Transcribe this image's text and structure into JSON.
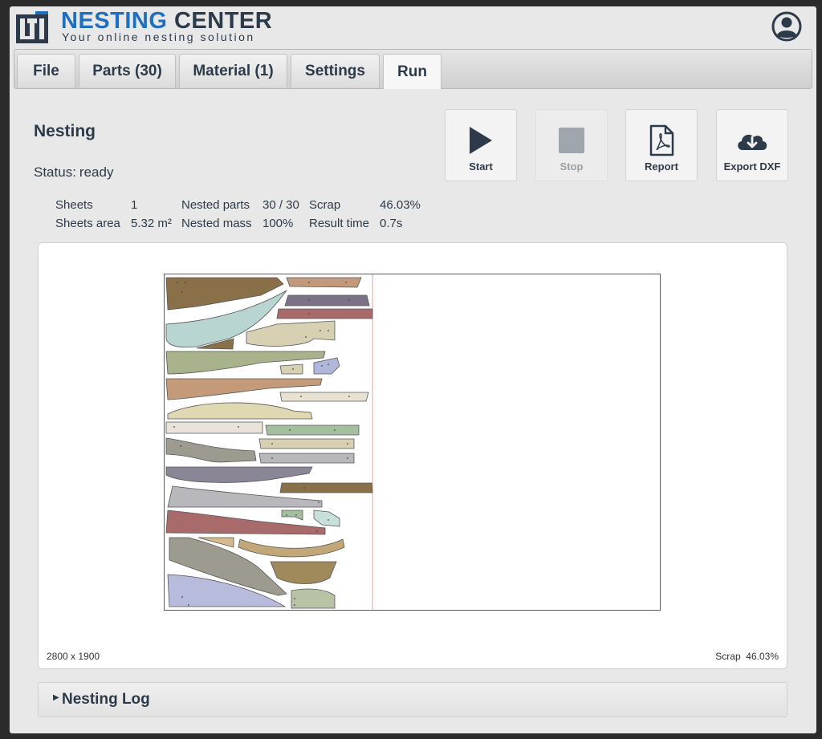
{
  "brand": {
    "name_part1": "NESTING",
    "name_part2": "CENTER",
    "tagline": "Your online nesting solution"
  },
  "tabs": [
    {
      "label": "File"
    },
    {
      "label": "Parts (30)"
    },
    {
      "label": "Material (1)"
    },
    {
      "label": "Settings"
    },
    {
      "label": "Run",
      "active": true
    }
  ],
  "page": {
    "title": "Nesting",
    "status_label": "Status:",
    "status_value": "ready"
  },
  "actions": {
    "start": "Start",
    "stop": "Stop",
    "report": "Report",
    "export": "Export DXF"
  },
  "stats": {
    "sheets_label": "Sheets",
    "sheets_value": "1",
    "sheets_area_label": "Sheets area",
    "sheets_area_value": "5.32 m²",
    "nested_parts_label": "Nested parts",
    "nested_parts_value": "30 / 30",
    "nested_mass_label": "Nested mass",
    "nested_mass_value": "100%",
    "scrap_label": "Scrap",
    "scrap_value": "46.03%",
    "result_time_label": "Result time",
    "result_time_value": "0.7s"
  },
  "canvas": {
    "dimensions": "2800 x 1900",
    "scrap_label": "Scrap",
    "scrap_value": "46.03%"
  },
  "log": {
    "title": "Nesting Log"
  },
  "colors": {
    "accent": "#1f6fbf",
    "text": "#2d3a4a"
  }
}
